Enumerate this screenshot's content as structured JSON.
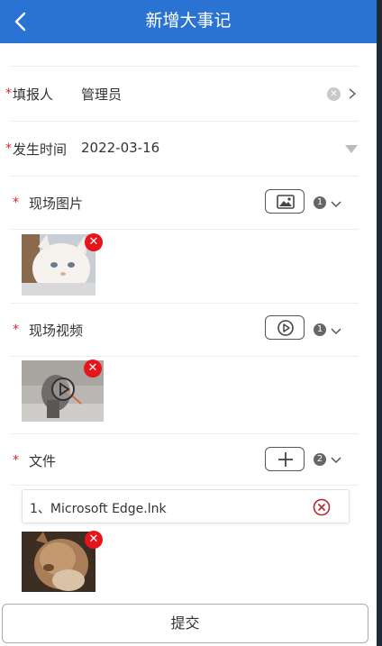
{
  "header": {
    "title": "新增大事记"
  },
  "form": {
    "reporter": {
      "required_mark": "*",
      "label": "填报人",
      "value": "管理员"
    },
    "occur_time": {
      "required_mark": "*",
      "label": "发生时间",
      "value": "2022-03-16"
    },
    "photos": {
      "required_mark": "*",
      "label": "现场图片",
      "count": "1"
    },
    "videos": {
      "required_mark": "*",
      "label": "现场视频",
      "count": "1"
    },
    "files": {
      "required_mark": "*",
      "label": "文件",
      "count": "2",
      "items": [
        {
          "name": "1、Microsoft Edge.lnk"
        }
      ]
    }
  },
  "submit_label": "提交",
  "colors": {
    "header": "#2b73d3",
    "required": "#d23",
    "delete": "#e8141c"
  }
}
